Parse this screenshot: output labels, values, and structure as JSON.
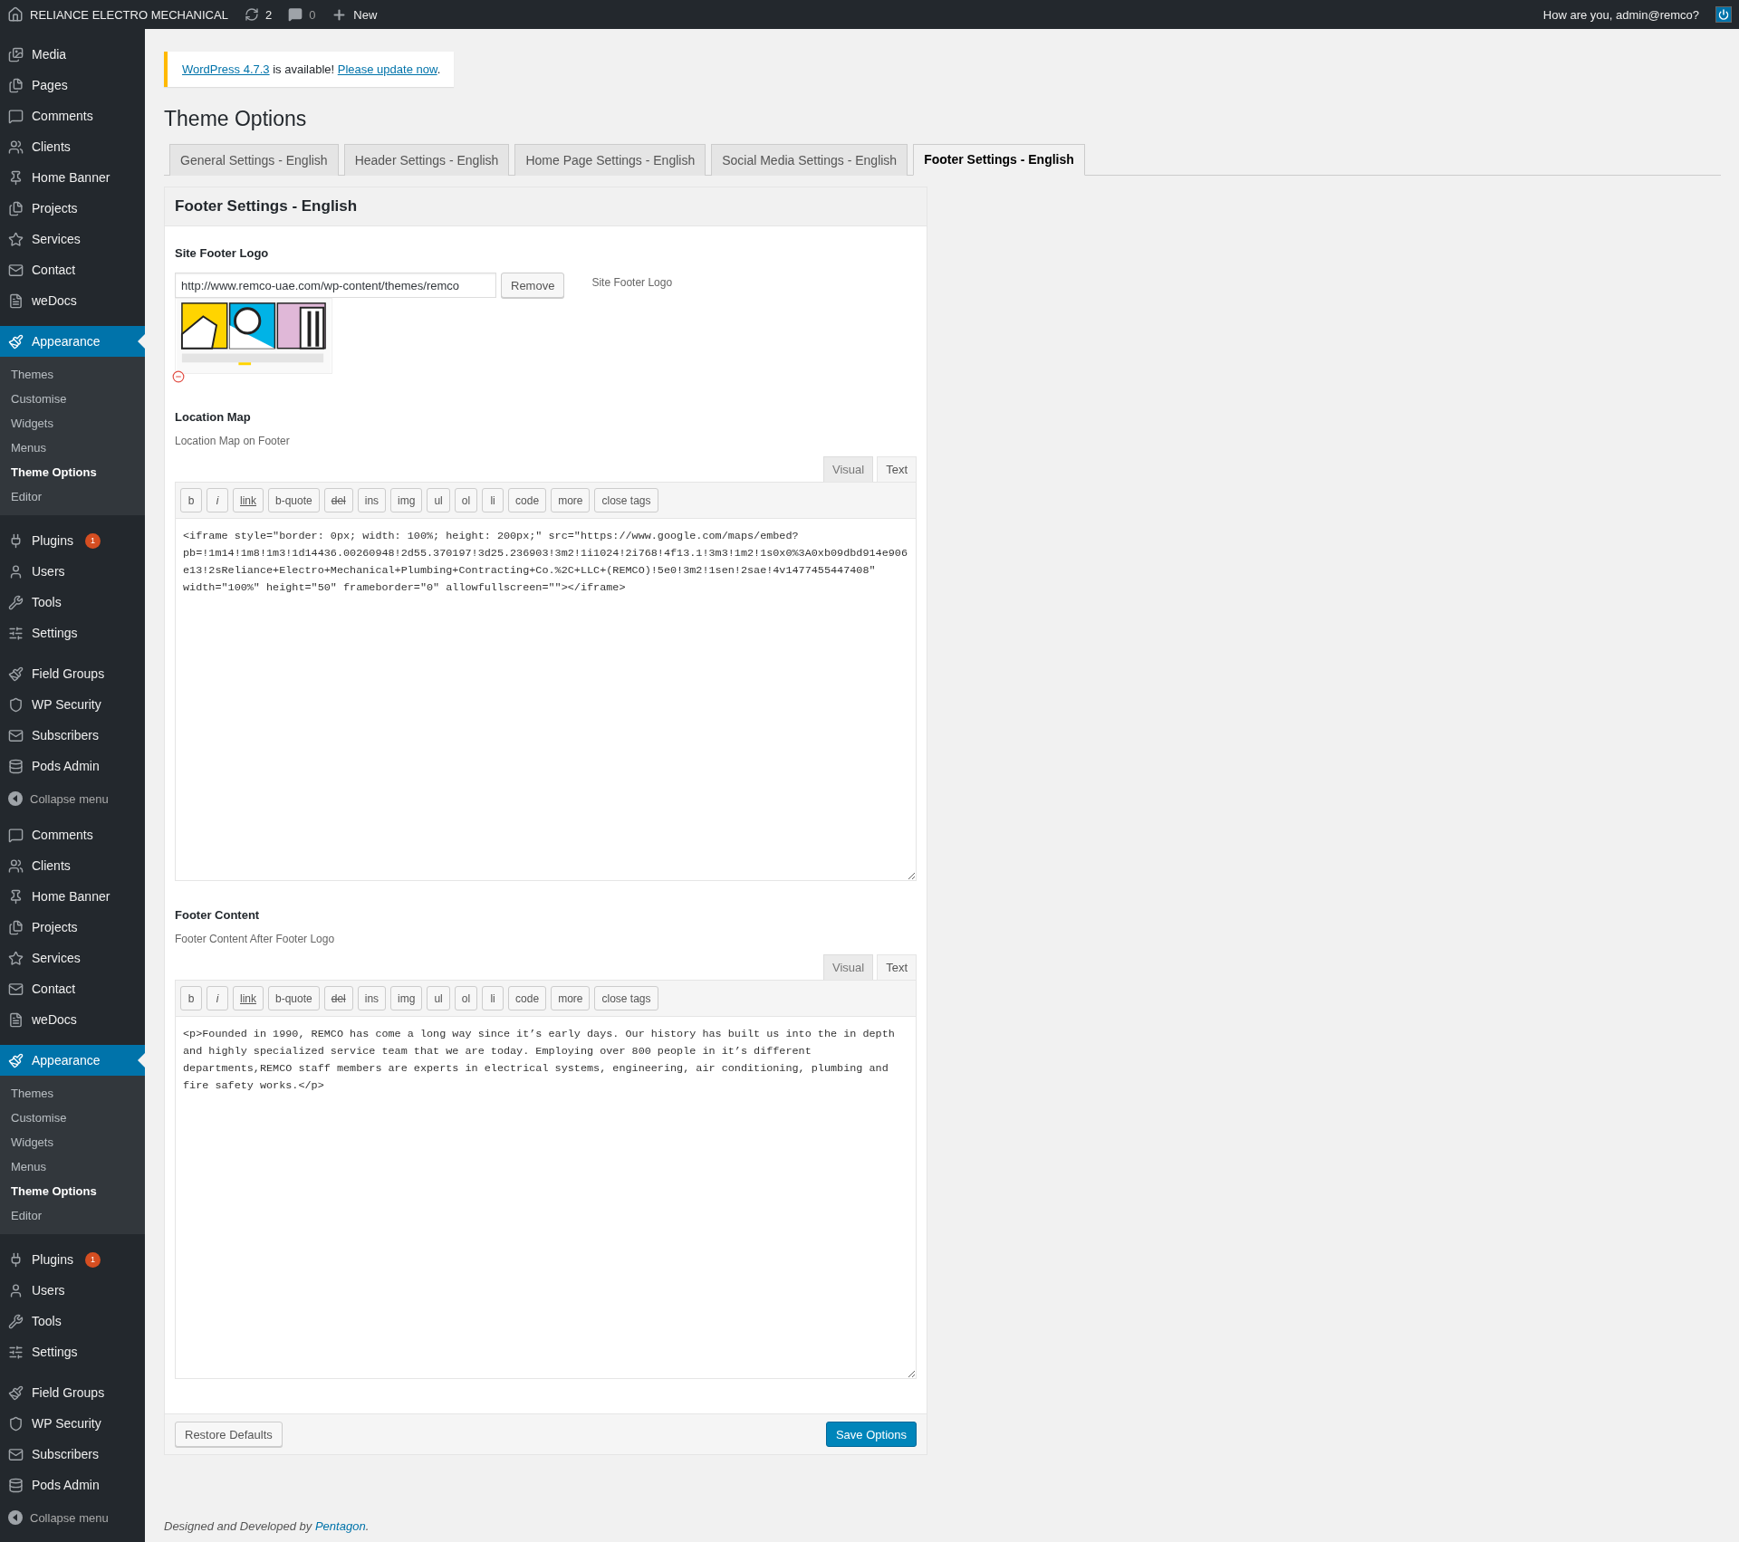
{
  "admin_bar": {
    "site_name": "RELIANCE ELECTRO MECHANICAL",
    "updates": "2",
    "comments": "0",
    "new_label": "New",
    "greeting": "How are you, admin@remco?"
  },
  "sidebar": {
    "menus": [
      {
        "items": [
          {
            "label": "Media",
            "selected": false
          },
          {
            "label": "Pages",
            "selected": false
          },
          {
            "label": "Comments",
            "selected": false
          },
          {
            "label": "Clients",
            "selected": false
          },
          {
            "label": "Home Banner",
            "selected": false
          },
          {
            "label": "Projects",
            "selected": false
          },
          {
            "label": "Services",
            "selected": false
          },
          {
            "label": "Contact",
            "selected": false
          },
          {
            "label": "weDocs",
            "selected": false
          },
          {
            "label": "Appearance",
            "selected": true,
            "submenu": [
              {
                "label": "Themes",
                "selected": false
              },
              {
                "label": "Customise",
                "selected": false
              },
              {
                "label": "Widgets",
                "selected": false
              },
              {
                "label": "Menus",
                "selected": false
              },
              {
                "label": "Theme Options",
                "selected": true
              },
              {
                "label": "Editor",
                "selected": false
              }
            ]
          },
          {
            "label": "Plugins",
            "selected": false,
            "badge": "1"
          },
          {
            "label": "Users",
            "selected": false
          },
          {
            "label": "Tools",
            "selected": false
          },
          {
            "label": "Settings",
            "selected": false
          },
          {
            "label": "Field Groups",
            "selected": false
          },
          {
            "label": "WP Security",
            "selected": false
          },
          {
            "label": "Subscribers",
            "selected": false
          },
          {
            "label": "Pods Admin",
            "selected": false
          }
        ],
        "collapse_label": "Collapse menu"
      },
      {
        "items": [
          {
            "label": "Comments",
            "selected": false
          },
          {
            "label": "Clients",
            "selected": false
          },
          {
            "label": "Home Banner",
            "selected": false
          },
          {
            "label": "Projects",
            "selected": false
          },
          {
            "label": "Services",
            "selected": false
          },
          {
            "label": "Contact",
            "selected": false
          },
          {
            "label": "weDocs",
            "selected": false
          },
          {
            "label": "Appearance",
            "selected": true,
            "submenu": [
              {
                "label": "Themes",
                "selected": false
              },
              {
                "label": "Customise",
                "selected": false
              },
              {
                "label": "Widgets",
                "selected": false
              },
              {
                "label": "Menus",
                "selected": false
              },
              {
                "label": "Theme Options",
                "selected": true
              },
              {
                "label": "Editor",
                "selected": false
              }
            ]
          },
          {
            "label": "Plugins",
            "selected": false,
            "badge": "1"
          },
          {
            "label": "Users",
            "selected": false
          },
          {
            "label": "Tools",
            "selected": false
          },
          {
            "label": "Settings",
            "selected": false
          },
          {
            "label": "Field Groups",
            "selected": false
          },
          {
            "label": "WP Security",
            "selected": false
          },
          {
            "label": "Subscribers",
            "selected": false
          },
          {
            "label": "Pods Admin",
            "selected": false
          }
        ],
        "collapse_label": "Collapse menu"
      }
    ]
  },
  "notice": {
    "link1": "WordPress 4.7.3",
    "text": " is available! ",
    "link2": "Please update now",
    "end": "."
  },
  "page_title": "Theme Options",
  "tabs": [
    {
      "label": "General Settings - English",
      "selected": false
    },
    {
      "label": "Header Settings - English",
      "selected": false
    },
    {
      "label": "Home Page Settings - English",
      "selected": false
    },
    {
      "label": "Social Media Settings - English",
      "selected": false
    },
    {
      "label": "Footer Settings - English",
      "selected": true
    }
  ],
  "panel": {
    "title": "Footer Settings - English",
    "logo_field": {
      "label": "Site Footer Logo",
      "value": "http://www.remco-uae.com/wp-content/themes/remco",
      "remove_button": "Remove",
      "description": "Site Footer Logo"
    },
    "editors": [
      {
        "label": "Location Map",
        "description": "Location Map on Footer",
        "modes": [
          {
            "label": "Visual",
            "selected": false
          },
          {
            "label": "Text",
            "selected": true
          }
        ],
        "toolbar": [
          {
            "label": "b",
            "kind": "plain"
          },
          {
            "label": "i",
            "kind": "italic"
          },
          {
            "label": "link",
            "kind": "link"
          },
          {
            "label": "b-quote",
            "kind": "plain"
          },
          {
            "label": "del",
            "kind": "strike"
          },
          {
            "label": "ins",
            "kind": "plain"
          },
          {
            "label": "img",
            "kind": "plain"
          },
          {
            "label": "ul",
            "kind": "plain"
          },
          {
            "label": "ol",
            "kind": "plain"
          },
          {
            "label": "li",
            "kind": "plain"
          },
          {
            "label": "code",
            "kind": "plain"
          },
          {
            "label": "more",
            "kind": "plain"
          },
          {
            "label": "close tags",
            "kind": "plain"
          }
        ],
        "content": "<iframe style=\"border: 0px; width: 100%; height: 200px;\" src=\"https://www.google.com/maps/embed?pb=!1m14!1m8!1m3!1d14436.00260948!2d55.370197!3d25.236903!3m2!1i1024!2i768!4f13.1!3m3!1m2!1s0x0%3A0xb09dbd914e906e13!2sReliance+Electro+Mechanical+Plumbing+Contracting+Co.%2C+LLC+(REMCO)!5e0!3m2!1sen!2sae!4v1477455447408\" width=\"100%\" height=\"50\" frameborder=\"0\" allowfullscreen=\"\"></iframe>"
      },
      {
        "label": "Footer Content",
        "description": "Footer Content After Footer Logo",
        "modes": [
          {
            "label": "Visual",
            "selected": false
          },
          {
            "label": "Text",
            "selected": true
          }
        ],
        "toolbar": [
          {
            "label": "b",
            "kind": "plain"
          },
          {
            "label": "i",
            "kind": "italic"
          },
          {
            "label": "link",
            "kind": "link"
          },
          {
            "label": "b-quote",
            "kind": "plain"
          },
          {
            "label": "del",
            "kind": "strike"
          },
          {
            "label": "ins",
            "kind": "plain"
          },
          {
            "label": "img",
            "kind": "plain"
          },
          {
            "label": "ul",
            "kind": "plain"
          },
          {
            "label": "ol",
            "kind": "plain"
          },
          {
            "label": "li",
            "kind": "plain"
          },
          {
            "label": "code",
            "kind": "plain"
          },
          {
            "label": "more",
            "kind": "plain"
          },
          {
            "label": "close tags",
            "kind": "plain"
          }
        ],
        "content": "<p>Founded in 1990, REMCO has come a long way since it’s early days. Our history has built us into the in depth and highly specialized service team that we are today. Employing over 800 people in it’s different departments,REMCO staff members are experts in electrical systems, engineering, air conditioning, plumbing and fire safety works.</p>"
      }
    ],
    "restore_button": "Restore Defaults",
    "save_button": "Save Options"
  },
  "footer": {
    "text": "Designed and Developed by ",
    "link": "Pentagon",
    "end": "."
  }
}
